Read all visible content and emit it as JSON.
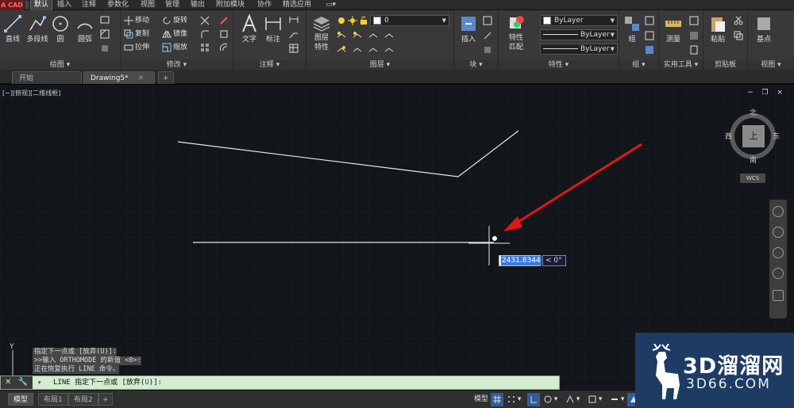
{
  "app": {
    "app_button_label": "A CAD",
    "ribbon_tabs": [
      "默认",
      "插入",
      "注释",
      "参数化",
      "视图",
      "管理",
      "输出",
      "附加模块",
      "协作",
      "精选应用"
    ],
    "active_tab": "默认"
  },
  "ribbon": {
    "draw": {
      "title": "绘图",
      "buttons": [
        "直线",
        "多段线",
        "圆",
        "圆弧"
      ]
    },
    "modify": {
      "title": "修改",
      "buttons": [
        "移动",
        "旋转",
        "复制",
        "镜像",
        "拉伸",
        "缩放"
      ]
    },
    "annotation": {
      "title": "注释",
      "buttons": [
        "文字",
        "标注"
      ]
    },
    "layers": {
      "title": "图层",
      "layer_props_label": "图层\n特性",
      "current_layer": "0"
    },
    "block": {
      "title": "块",
      "insert_label": "插入"
    },
    "properties": {
      "title": "特性",
      "match_label": "特性\n匹配",
      "color": "ByLayer",
      "linetype": "ByLayer",
      "lineweight": "ByLayer"
    },
    "groups": {
      "title": "组",
      "group_label": "组"
    },
    "utilities": {
      "title": "实用工具",
      "measure_label": "测量"
    },
    "clipboard": {
      "title": "剪贴板",
      "paste_label": "粘贴"
    },
    "view": {
      "title": "视图",
      "base_label": "基点"
    }
  },
  "doc_tabs": {
    "start": "开始",
    "drawing": "Drawing5*",
    "add": "+"
  },
  "viewport": {
    "label": "[−][俯视][二维线框]",
    "controls": "− ❐ ×"
  },
  "viewcube": {
    "north": "北",
    "south": "南",
    "east": "东",
    "west": "西",
    "face": "上",
    "wcs": "WCS"
  },
  "dynamic_input": {
    "distance": "2431.8344",
    "angle": "< 0°"
  },
  "ucs": {
    "y_label": "Y"
  },
  "command_history": [
    "指定下一点或 [放弃(U)]:",
    ">>输入 ORTHOMODE 的新值 <0>:",
    "正在恢复执行 LINE 命令。"
  ],
  "command_line": {
    "prompt_prefix": "LINE 指定下一点或 [放弃(",
    "prompt_key": "U",
    "prompt_suffix": ")]:"
  },
  "layout_tabs": [
    "模型",
    "布局1",
    "布局2"
  ],
  "status_bar": {
    "model_label": "模型"
  },
  "watermark": {
    "line1": "3D溜溜网",
    "line2": "3D66.COM"
  },
  "colors": {
    "canvas_bg": "#212830",
    "arrow": "#e01818",
    "command_line_bg": "#d4ecd0",
    "watermark_bg": "#1e3c63"
  }
}
